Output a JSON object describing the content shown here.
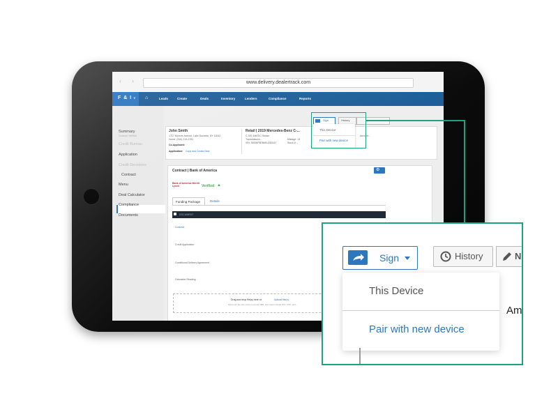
{
  "browser": {
    "url": "www.delivery.dealertrack.com"
  },
  "topnav": {
    "brand": "F & I",
    "items": [
      "Leads",
      "Create",
      "Deals",
      "Inventory",
      "Lenders",
      "Compliance",
      "Reports"
    ]
  },
  "sidebar": {
    "items": [
      {
        "label": "Summary",
        "sub": "Contract Verified",
        "dim": false
      },
      {
        "label": "Credit Bureau",
        "dim": true
      },
      {
        "label": "Application",
        "dim": false
      },
      {
        "label": "Credit Decisions",
        "dim": true
      },
      {
        "label": "Contract",
        "dim": false,
        "active": true
      },
      {
        "label": "Menu",
        "dim": false
      },
      {
        "label": "Deal Calculator",
        "dim": false
      },
      {
        "label": "Compliance",
        "dim": false
      },
      {
        "label": "Documents",
        "dim": false
      }
    ]
  },
  "customer": {
    "name": "John Smith",
    "address": "1717 Monroe Avenue, Lake Success, NY 11042",
    "home": "Home: (516) 215-2151",
    "coapplicant": "Co-Applicant:",
    "application_label": "Application:",
    "application_link": "Copy and Create New"
  },
  "vehicle": {
    "title": "Retail | 2019 Mercedes-Benz C-...",
    "model": "C 300 4MATIC Sedan",
    "transmission": "Transmission: -",
    "vin": "VIN: 55SWF8EB6KU284167",
    "mileage": "Mileage: 13",
    "stock": "Stock #: -",
    "amount": "Amount: -"
  },
  "toolbar": {
    "sign": "Sign",
    "history": "History",
    "notes_abbr": "N",
    "dropdown_item_1": "This Device",
    "dropdown_item_2": "Pair with new device"
  },
  "contract": {
    "title": "Contract | Bank of America",
    "lender_logo": "Bank of America Merrill Lynch",
    "verified": "Verified",
    "tabs": [
      "Funding Package",
      "Details"
    ],
    "table_header": "DOCUMENT",
    "docs": [
      "Contract",
      "Credit Application",
      "Conditional Delivery Agreement",
      "Odometer Reading"
    ],
    "drop_text": "Drag and drop file(s) here or",
    "drop_link": "Upload file(s)",
    "drop_hint": "Maximum file size cannot exceed 4MB. File types include JPG, PDF, and..."
  },
  "zoom": {
    "amount_partial": "Am"
  },
  "colors": {
    "accent": "#2d77c1",
    "nav": "#1f5f99",
    "callout": "#1aa37e",
    "verified": "#4caf50"
  }
}
